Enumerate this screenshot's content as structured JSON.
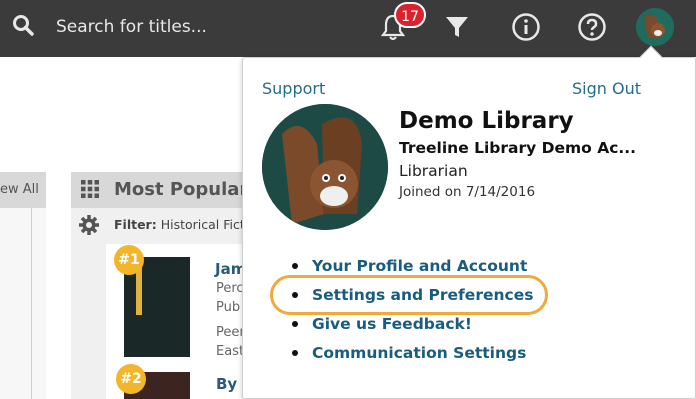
{
  "topbar": {
    "search_placeholder": "Search for titles...",
    "notification_count": "17"
  },
  "left_panel": {
    "view_all_label": "ew All"
  },
  "most_popular": {
    "title": "Most Popular",
    "filter_label": "Filter:",
    "filter_value": "Historical Ficti",
    "books": [
      {
        "rank": "#1",
        "title": "Jam",
        "lines": [
          "Perc",
          "Pub",
          "Peer",
          "East"
        ]
      },
      {
        "rank": "#2",
        "title": "By A",
        "lines": []
      }
    ]
  },
  "profile_popover": {
    "support_label": "Support",
    "sign_out_label": "Sign Out",
    "name": "Demo Library",
    "organization": "Treeline Library Demo Ac...",
    "role": "Librarian",
    "joined": "Joined on 7/14/2016",
    "menu": [
      "Your Profile and Account",
      "Settings and Preferences",
      "Give us Feedback!",
      "Communication Settings"
    ]
  },
  "colors": {
    "topbar": "#3b3b3b",
    "link": "#1a5c7e",
    "highlight": "#f2a93b",
    "badge": "#d9232e",
    "rank": "#f3b52a"
  },
  "icons": [
    "search-icon",
    "bell-icon",
    "filter-icon",
    "info-icon",
    "help-icon",
    "grid-icon",
    "gear-icon",
    "plus-circle-icon"
  ]
}
